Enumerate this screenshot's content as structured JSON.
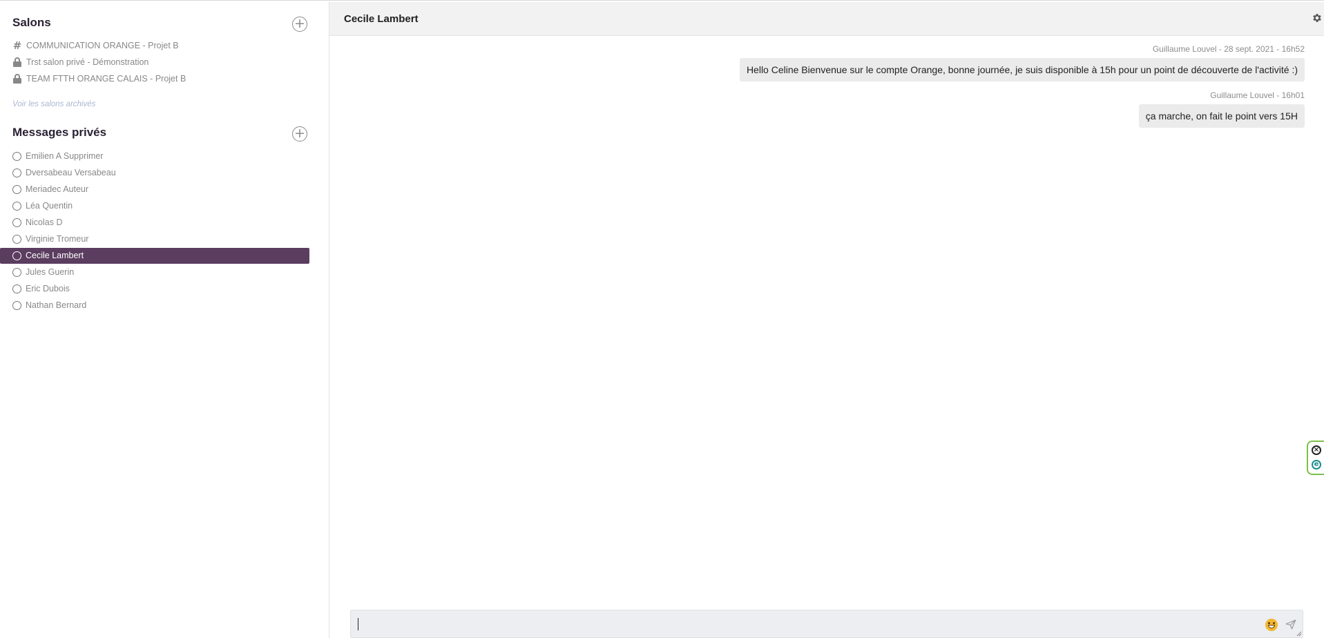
{
  "sidebar": {
    "rooms_title": "Salons",
    "rooms": [
      {
        "label": "COMMUNICATION ORANGE - Projet B",
        "icon": "hash-icon"
      },
      {
        "label": "Trst salon privé - Démonstration",
        "icon": "lock-icon"
      },
      {
        "label": "TEAM FTTH ORANGE CALAIS - Projet B",
        "icon": "lock-icon"
      }
    ],
    "archived_link": "Voir les salons archivés",
    "dm_title": "Messages privés",
    "contacts": [
      {
        "label": "Emilien A Supprimer"
      },
      {
        "label": "Dversabeau Versabeau"
      },
      {
        "label": "Meriadec Auteur"
      },
      {
        "label": "Léa Quentin"
      },
      {
        "label": "Nicolas D"
      },
      {
        "label": "Virginie Tromeur"
      },
      {
        "label": "Cecile Lambert",
        "selected": true
      },
      {
        "label": "Jules Guerin"
      },
      {
        "label": "Eric Dubois"
      },
      {
        "label": "Nathan Bernard"
      }
    ],
    "add_symbol": "+"
  },
  "conversation": {
    "title": "Cecile Lambert",
    "messages": [
      {
        "meta": "Guillaume Louvel - 28 sept. 2021 - 16h52",
        "text": "Hello Celine Bienvenue sur le compte Orange, bonne journée, je suis disponible à 15h pour un point de découverte de l'activité :)"
      },
      {
        "meta": "Guillaume Louvel - 16h01",
        "text": "ça marche, on fait le point vers 15H"
      }
    ],
    "composer_value": ""
  },
  "extension": {
    "close_glyph": "×",
    "logo_glyph": "e"
  },
  "colors": {
    "accent": "#5b3d60",
    "header_bg": "#f2f2f2",
    "bubble_bg": "#ebebeb",
    "archived_link": "#a9b7d0",
    "extension_border": "#7cc04b"
  }
}
